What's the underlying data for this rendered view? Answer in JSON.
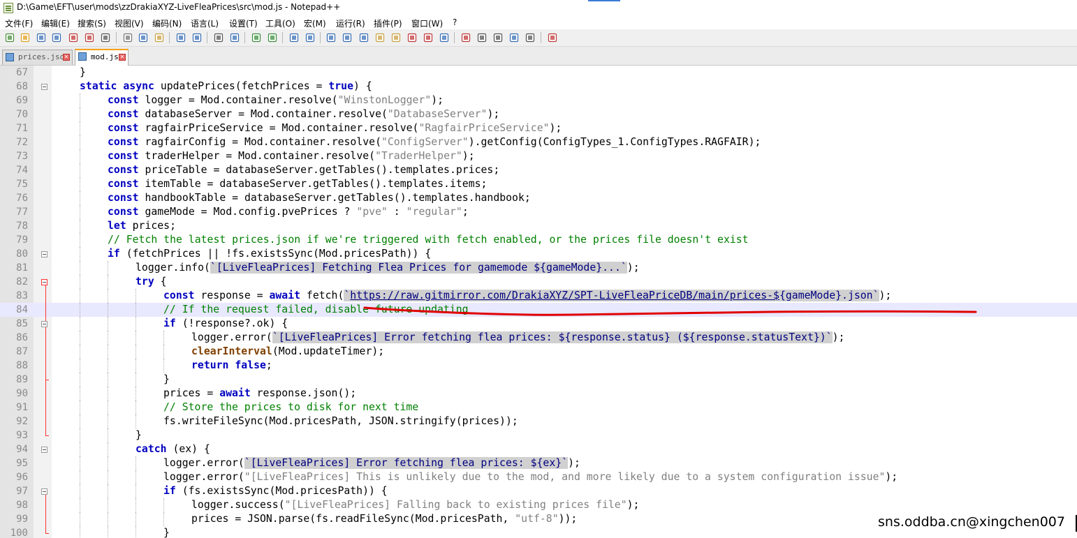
{
  "window": {
    "title": "D:\\Game\\EFT\\user\\mods\\zzDrakiaXYZ-LiveFleaPrices\\src\\mod.js - Notepad++"
  },
  "menu": [
    "文件(F)",
    "编辑(E)",
    "搜索(S)",
    "视图(V)",
    "编码(N)",
    "语言(L)",
    "设置(T)",
    "工具(O)",
    "宏(M)",
    "运行(R)",
    "插件(P)",
    "窗口(W)",
    "?"
  ],
  "toolbar_icons": [
    "new-file-icon",
    "open-file-icon",
    "save-icon",
    "save-all-icon",
    "close-icon",
    "close-all-icon",
    "print-icon",
    "cut-icon",
    "copy-icon",
    "paste-icon",
    "undo-icon",
    "redo-icon",
    "find-icon",
    "replace-icon",
    "zoom-in-icon",
    "zoom-out-icon",
    "sync-vertical-icon",
    "sync-horizontal-icon",
    "word-wrap-icon",
    "show-all-chars-icon",
    "indent-guide-icon",
    "udl-icon",
    "doc-map-icon",
    "function-list-icon",
    "folder-workspace-icon",
    "monitoring-icon",
    "record-macro-icon",
    "stop-record-icon",
    "play-macro-icon",
    "run-macro-multiple-icon",
    "save-macro-icon",
    "spellcheck-icon"
  ],
  "tabs": [
    {
      "label": "prices.json",
      "active": false
    },
    {
      "label": "mod.js",
      "active": true
    }
  ],
  "lines": [
    {
      "n": "67",
      "indent": 1,
      "tokens": [
        [
          "p",
          "}"
        ]
      ]
    },
    {
      "n": "68",
      "indent": 1,
      "tokens": [
        [
          "kw",
          "static"
        ],
        [
          "p",
          " "
        ],
        [
          "kw",
          "async"
        ],
        [
          "p",
          " updatePrices(fetchPrices = "
        ],
        [
          "kw",
          "true"
        ],
        [
          "p",
          ") {"
        ]
      ]
    },
    {
      "n": "69",
      "indent": 2,
      "tokens": [
        [
          "kw",
          "const"
        ],
        [
          "p",
          " logger = Mod.container.resolve("
        ],
        [
          "str",
          "\"WinstonLogger\""
        ],
        [
          "p",
          ");"
        ]
      ]
    },
    {
      "n": "70",
      "indent": 2,
      "tokens": [
        [
          "kw",
          "const"
        ],
        [
          "p",
          " databaseServer = Mod.container.resolve("
        ],
        [
          "str",
          "\"DatabaseServer\""
        ],
        [
          "p",
          ");"
        ]
      ]
    },
    {
      "n": "71",
      "indent": 2,
      "tokens": [
        [
          "kw",
          "const"
        ],
        [
          "p",
          " ragfairPriceService = Mod.container.resolve("
        ],
        [
          "str",
          "\"RagfairPriceService\""
        ],
        [
          "p",
          ");"
        ]
      ]
    },
    {
      "n": "72",
      "indent": 2,
      "tokens": [
        [
          "kw",
          "const"
        ],
        [
          "p",
          " ragfairConfig = Mod.container.resolve("
        ],
        [
          "str",
          "\"ConfigServer\""
        ],
        [
          "p",
          ").getConfig(ConfigTypes_1.ConfigTypes.RAGFAIR);"
        ]
      ]
    },
    {
      "n": "73",
      "indent": 2,
      "tokens": [
        [
          "kw",
          "const"
        ],
        [
          "p",
          " traderHelper = Mod.container.resolve("
        ],
        [
          "str",
          "\"TraderHelper\""
        ],
        [
          "p",
          ");"
        ]
      ]
    },
    {
      "n": "74",
      "indent": 2,
      "tokens": [
        [
          "kw",
          "const"
        ],
        [
          "p",
          " priceTable = databaseServer.getTables().templates.prices;"
        ]
      ]
    },
    {
      "n": "75",
      "indent": 2,
      "tokens": [
        [
          "kw",
          "const"
        ],
        [
          "p",
          " itemTable = databaseServer.getTables().templates.items;"
        ]
      ]
    },
    {
      "n": "76",
      "indent": 2,
      "tokens": [
        [
          "kw",
          "const"
        ],
        [
          "p",
          " handbookTable = databaseServer.getTables().templates.handbook;"
        ]
      ]
    },
    {
      "n": "77",
      "indent": 2,
      "tokens": [
        [
          "kw",
          "const"
        ],
        [
          "p",
          " gameMode = Mod.config.pvePrices ? "
        ],
        [
          "str",
          "\"pve\""
        ],
        [
          "p",
          " : "
        ],
        [
          "str",
          "\"regular\""
        ],
        [
          "p",
          ";"
        ]
      ]
    },
    {
      "n": "78",
      "indent": 2,
      "tokens": [
        [
          "kw",
          "let"
        ],
        [
          "p",
          " prices;"
        ]
      ]
    },
    {
      "n": "79",
      "indent": 2,
      "tokens": [
        [
          "cmt",
          "// Fetch the latest prices.json if we're triggered with fetch enabled, or the prices file doesn't exist"
        ]
      ]
    },
    {
      "n": "80",
      "indent": 2,
      "tokens": [
        [
          "kw",
          "if"
        ],
        [
          "p",
          " (fetchPrices || !fs.existsSync(Mod.pricesPath)) {"
        ]
      ]
    },
    {
      "n": "81",
      "indent": 3,
      "tokens": [
        [
          "p",
          "logger.info("
        ],
        [
          "tpl",
          "`[LiveFleaPrices] Fetching Flea Prices for gamemode ${gameMode}...`"
        ],
        [
          "p",
          ");"
        ]
      ]
    },
    {
      "n": "82",
      "indent": 3,
      "tokens": [
        [
          "kw",
          "try"
        ],
        [
          "p",
          " {"
        ]
      ]
    },
    {
      "n": "83",
      "indent": 4,
      "tokens": [
        [
          "kw",
          "const"
        ],
        [
          "p",
          " response = "
        ],
        [
          "kw",
          "await"
        ],
        [
          "p",
          " fetch("
        ],
        [
          "tpl",
          "`"
        ],
        [
          "url",
          "https://raw.gitmirror.com/DrakiaXYZ/SPT-LiveFleaPriceDB/main/prices-$"
        ],
        [
          "tpl",
          "{gameMode}.json`"
        ],
        [
          "p",
          ");"
        ]
      ]
    },
    {
      "n": "84",
      "indent": 4,
      "tokens": [
        [
          "cmt",
          "// If the request failed, disable future updating"
        ]
      ]
    },
    {
      "n": "85",
      "indent": 4,
      "tokens": [
        [
          "kw",
          "if"
        ],
        [
          "p",
          " (!response?.ok) {"
        ]
      ]
    },
    {
      "n": "86",
      "indent": 5,
      "tokens": [
        [
          "p",
          "logger.error("
        ],
        [
          "tpl",
          "`[LiveFleaPrices] Error fetching flea prices: ${response.status} (${response.statusText})`"
        ],
        [
          "p",
          ");"
        ]
      ]
    },
    {
      "n": "87",
      "indent": 5,
      "tokens": [
        [
          "fn",
          "clearInterval"
        ],
        [
          "p",
          "(Mod.updateTimer);"
        ]
      ]
    },
    {
      "n": "88",
      "indent": 5,
      "tokens": [
        [
          "kw",
          "return"
        ],
        [
          "p",
          " "
        ],
        [
          "kw",
          "false"
        ],
        [
          "p",
          ";"
        ]
      ]
    },
    {
      "n": "89",
      "indent": 4,
      "tokens": [
        [
          "p",
          "}"
        ]
      ]
    },
    {
      "n": "90",
      "indent": 4,
      "tokens": [
        [
          "p",
          "prices = "
        ],
        [
          "kw",
          "await"
        ],
        [
          "p",
          " response.json();"
        ]
      ]
    },
    {
      "n": "91",
      "indent": 4,
      "tokens": [
        [
          "cmt",
          "// Store the prices to disk for next time"
        ]
      ]
    },
    {
      "n": "92",
      "indent": 4,
      "tokens": [
        [
          "p",
          "fs.writeFileSync(Mod.pricesPath, JSON.stringify(prices));"
        ]
      ]
    },
    {
      "n": "93",
      "indent": 3,
      "tokens": [
        [
          "p",
          "}"
        ]
      ]
    },
    {
      "n": "94",
      "indent": 3,
      "tokens": [
        [
          "kw",
          "catch"
        ],
        [
          "p",
          " (ex) {"
        ]
      ]
    },
    {
      "n": "95",
      "indent": 4,
      "tokens": [
        [
          "p",
          "logger.error("
        ],
        [
          "tpl",
          "`[LiveFleaPrices] Error fetching flea prices: ${ex}`"
        ],
        [
          "p",
          ");"
        ]
      ]
    },
    {
      "n": "96",
      "indent": 4,
      "tokens": [
        [
          "p",
          "logger.error("
        ],
        [
          "str",
          "\"[LiveFleaPrices] This is unlikely due to the mod, and more likely due to a system configuration issue\""
        ],
        [
          "p",
          ");"
        ]
      ]
    },
    {
      "n": "97",
      "indent": 4,
      "tokens": [
        [
          "kw",
          "if"
        ],
        [
          "p",
          " (fs.existsSync(Mod.pricesPath)) {"
        ]
      ]
    },
    {
      "n": "98",
      "indent": 5,
      "tokens": [
        [
          "p",
          "logger.success("
        ],
        [
          "str",
          "\"[LiveFleaPrices] Falling back to existing prices file\""
        ],
        [
          "p",
          ");"
        ]
      ]
    },
    {
      "n": "99",
      "indent": 5,
      "tokens": [
        [
          "p",
          "prices = JSON.parse(fs.readFileSync(Mod.pricesPath, "
        ],
        [
          "str",
          "\"utf-8\""
        ],
        [
          "p",
          "));"
        ]
      ]
    },
    {
      "n": "100",
      "indent": 4,
      "tokens": [
        [
          "p",
          "}"
        ]
      ]
    }
  ],
  "current_line": "84",
  "watermark": "sns.oddba.cn@xingchen007",
  "colors": {
    "keyword": "#0000c0",
    "string": "#808080",
    "comment": "#008000",
    "current_line_bg": "#e8e8ff",
    "annotation": "#e00000"
  }
}
